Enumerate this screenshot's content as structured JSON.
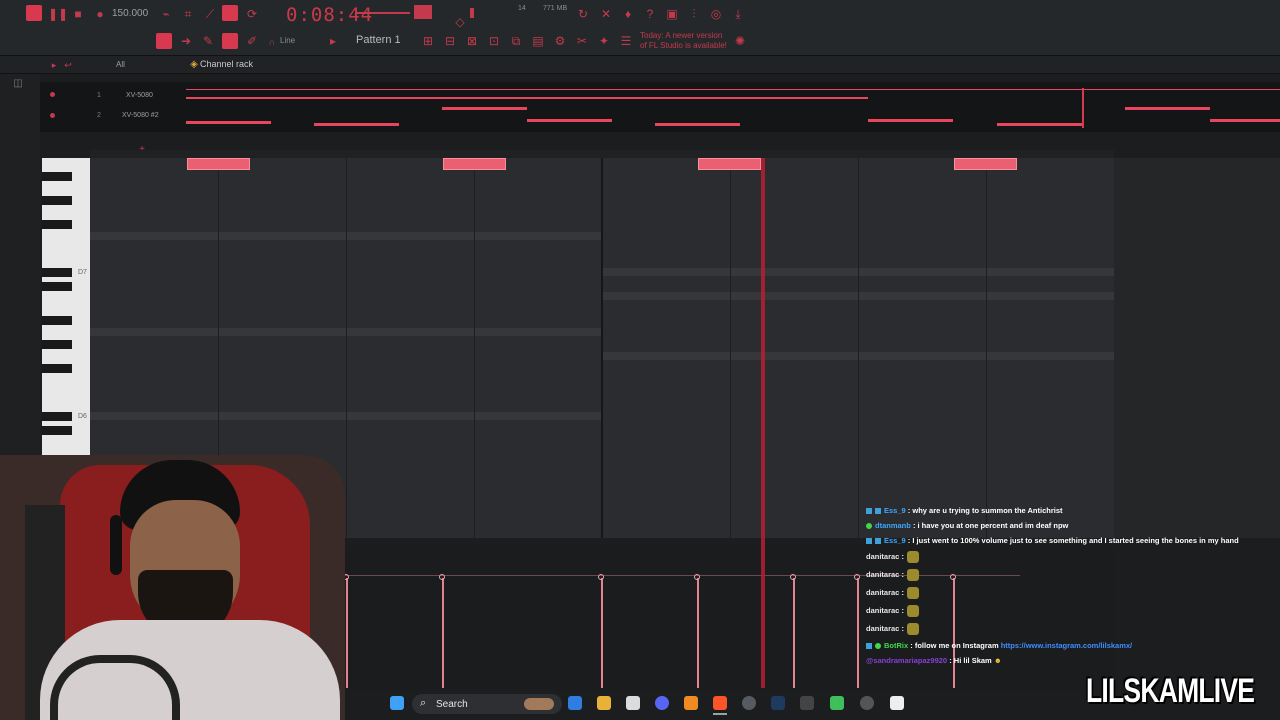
{
  "toolbar": {
    "tempo": "150.000",
    "time": "0:08:44",
    "pattern": "Pattern 1",
    "snap": "Line",
    "notice": "Today: A newer version of FL Studio is available!",
    "cpu": "771 MB",
    "voices": "14"
  },
  "channel_rack": {
    "filter": "All",
    "title": "Channel rack",
    "channels": [
      {
        "num": "1",
        "name": "XV-5080"
      },
      {
        "num": "2",
        "name": "XV-5080 #2"
      }
    ]
  },
  "piano_roll": {
    "octave_labels": [
      "D7",
      "D6"
    ]
  },
  "chat": {
    "messages": [
      {
        "user": "Ess_9",
        "text": ": why are u trying to summon the Antichrist"
      },
      {
        "user": "dtanmanb",
        "text": ": i have you at one percent and im deaf npw"
      },
      {
        "user": "Ess_9",
        "text": ": I just went to 100% volume just to see something and I started seeing the bones in my hand"
      },
      {
        "user": "danitarac",
        "text": ":"
      },
      {
        "user": "danitarac",
        "text": ":"
      },
      {
        "user": "danitarac",
        "text": ":"
      },
      {
        "user": "danitarac",
        "text": ":"
      },
      {
        "user": "danitarac",
        "text": ":"
      },
      {
        "user": "BotRix",
        "text": ": follow me on Instagram",
        "link": "https://www.instagram.com/lilskamx/"
      },
      {
        "user": "@sandramariapaz9920",
        "text": ": Hi lil Skam"
      }
    ]
  },
  "taskbar": {
    "search_label": "Search"
  },
  "brand": "LILSKAMLIVE",
  "colors": {
    "accent": "#e8465c",
    "playhead": "#b81d33",
    "background": "#1b1d1f"
  }
}
